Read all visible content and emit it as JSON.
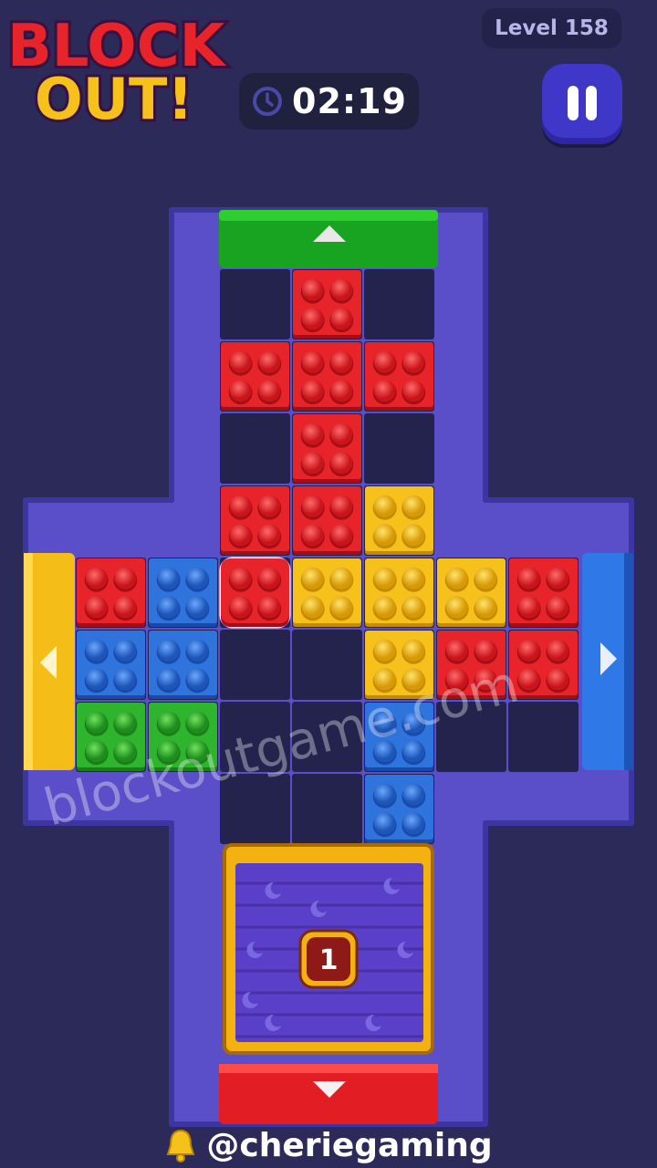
{
  "game": {
    "logo_line1": "BLOCK",
    "logo_line2": "OUT!",
    "level": "Level 158",
    "timer": "02:19",
    "door_count": "1",
    "watermark": "blockoutgame.com",
    "footer_handle": "@cheriegaming"
  },
  "colors": {
    "background": "#2b2a58",
    "frame": "#5a4fc8",
    "cell": "#24234e",
    "red": "#e8242b",
    "blue": "#2f74dd",
    "green": "#2fb52d",
    "yellow": "#f6c11a",
    "gate_green": "#18a321",
    "gate_red": "#e31d24",
    "gate_yellow": "#f5bd17",
    "gate_blue": "#2f78e8"
  },
  "icons": [
    "clock-icon",
    "pause-icon",
    "bell-icon",
    "arrow-up-icon",
    "arrow-down-icon",
    "arrow-left-icon",
    "arrow-right-icon",
    "moon-icon"
  ]
}
